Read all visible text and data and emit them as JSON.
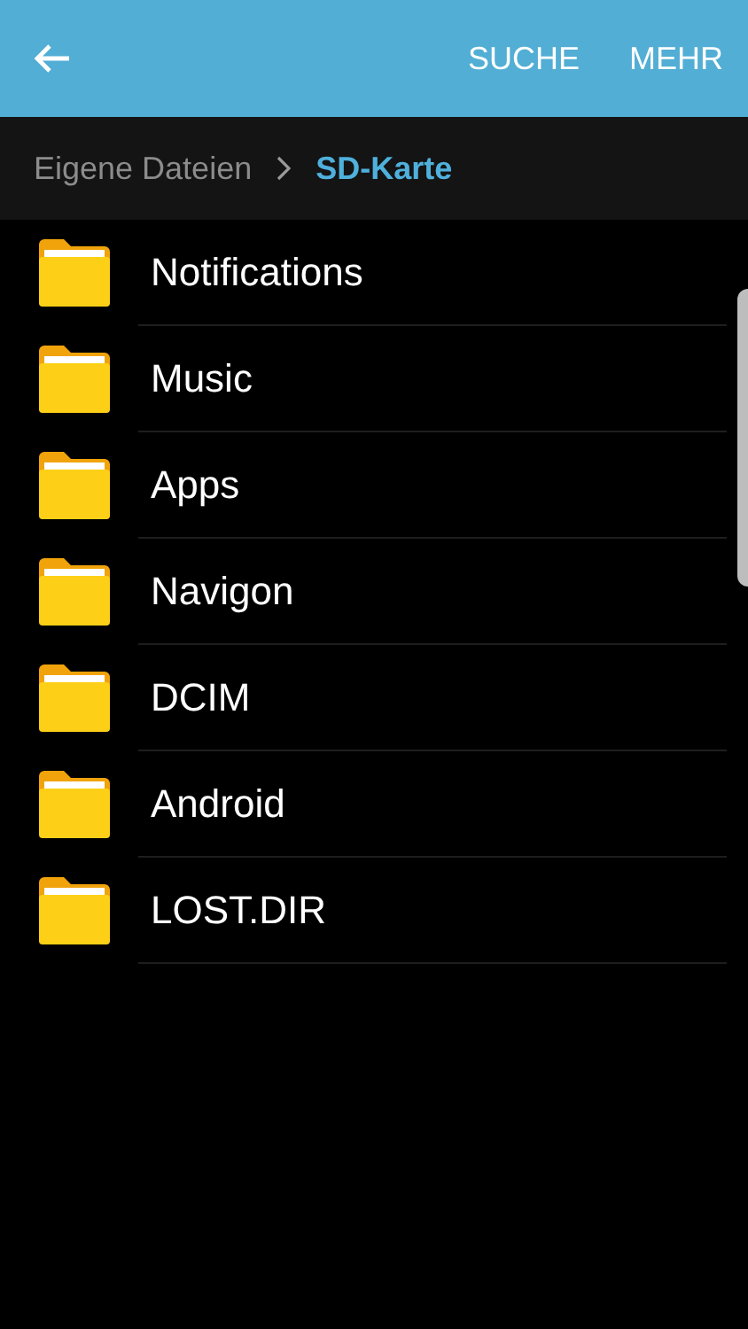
{
  "app_bar": {
    "actions": [
      "SUCHE",
      "MEHR"
    ]
  },
  "breadcrumb": [
    {
      "label": "Eigene Dateien",
      "selected": false
    },
    {
      "label": "SD-Karte",
      "selected": true
    }
  ],
  "folders": [
    {
      "name": "Notifications"
    },
    {
      "name": "Music"
    },
    {
      "name": "Apps"
    },
    {
      "name": "Navigon"
    },
    {
      "name": "DCIM"
    },
    {
      "name": "Android"
    },
    {
      "name": "LOST.DIR"
    }
  ]
}
